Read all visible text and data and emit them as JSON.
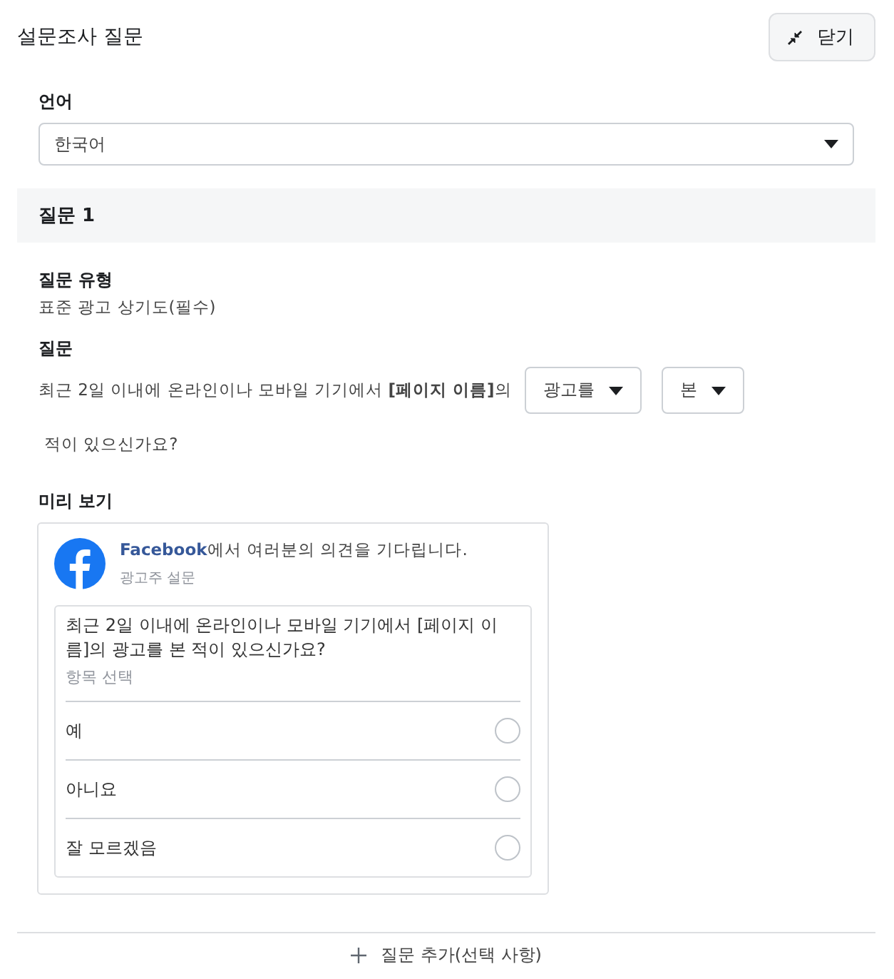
{
  "header": {
    "title": "설문조사 질문",
    "close_button": "닫기"
  },
  "language": {
    "label": "언어",
    "value": "한국어"
  },
  "question_section": {
    "title": "질문 1",
    "type_label": "질문 유형",
    "type_value": "표준 광고 상기도(필수)",
    "question_label": "질문",
    "question_prefix": "최근 2일 이내에 온라인이나 모바일 기기에서 **[페이지 이름]**의",
    "dropdowns": [
      {
        "value": "광고를"
      },
      {
        "value": "본"
      }
    ],
    "question_suffix": "적이 있으신가요?"
  },
  "preview": {
    "label": "미리 보기",
    "brand": "Facebook",
    "headline": "에서 여러분의 의견을 기다립니다.",
    "subtitle": "광고주 설문",
    "question": "최근 2일 이내에 온라인이나 모바일 기기에서 [페이지 이름]의 광고를 본 적이 있으신가요?",
    "hint": "항목 선택",
    "options": [
      {
        "label": "예",
        "selected": false
      },
      {
        "label": "아니요",
        "selected": false
      },
      {
        "label": "잘 모르겠음",
        "selected": false
      }
    ]
  },
  "add_question": {
    "label": "질문 추가(선택 사항)"
  }
}
